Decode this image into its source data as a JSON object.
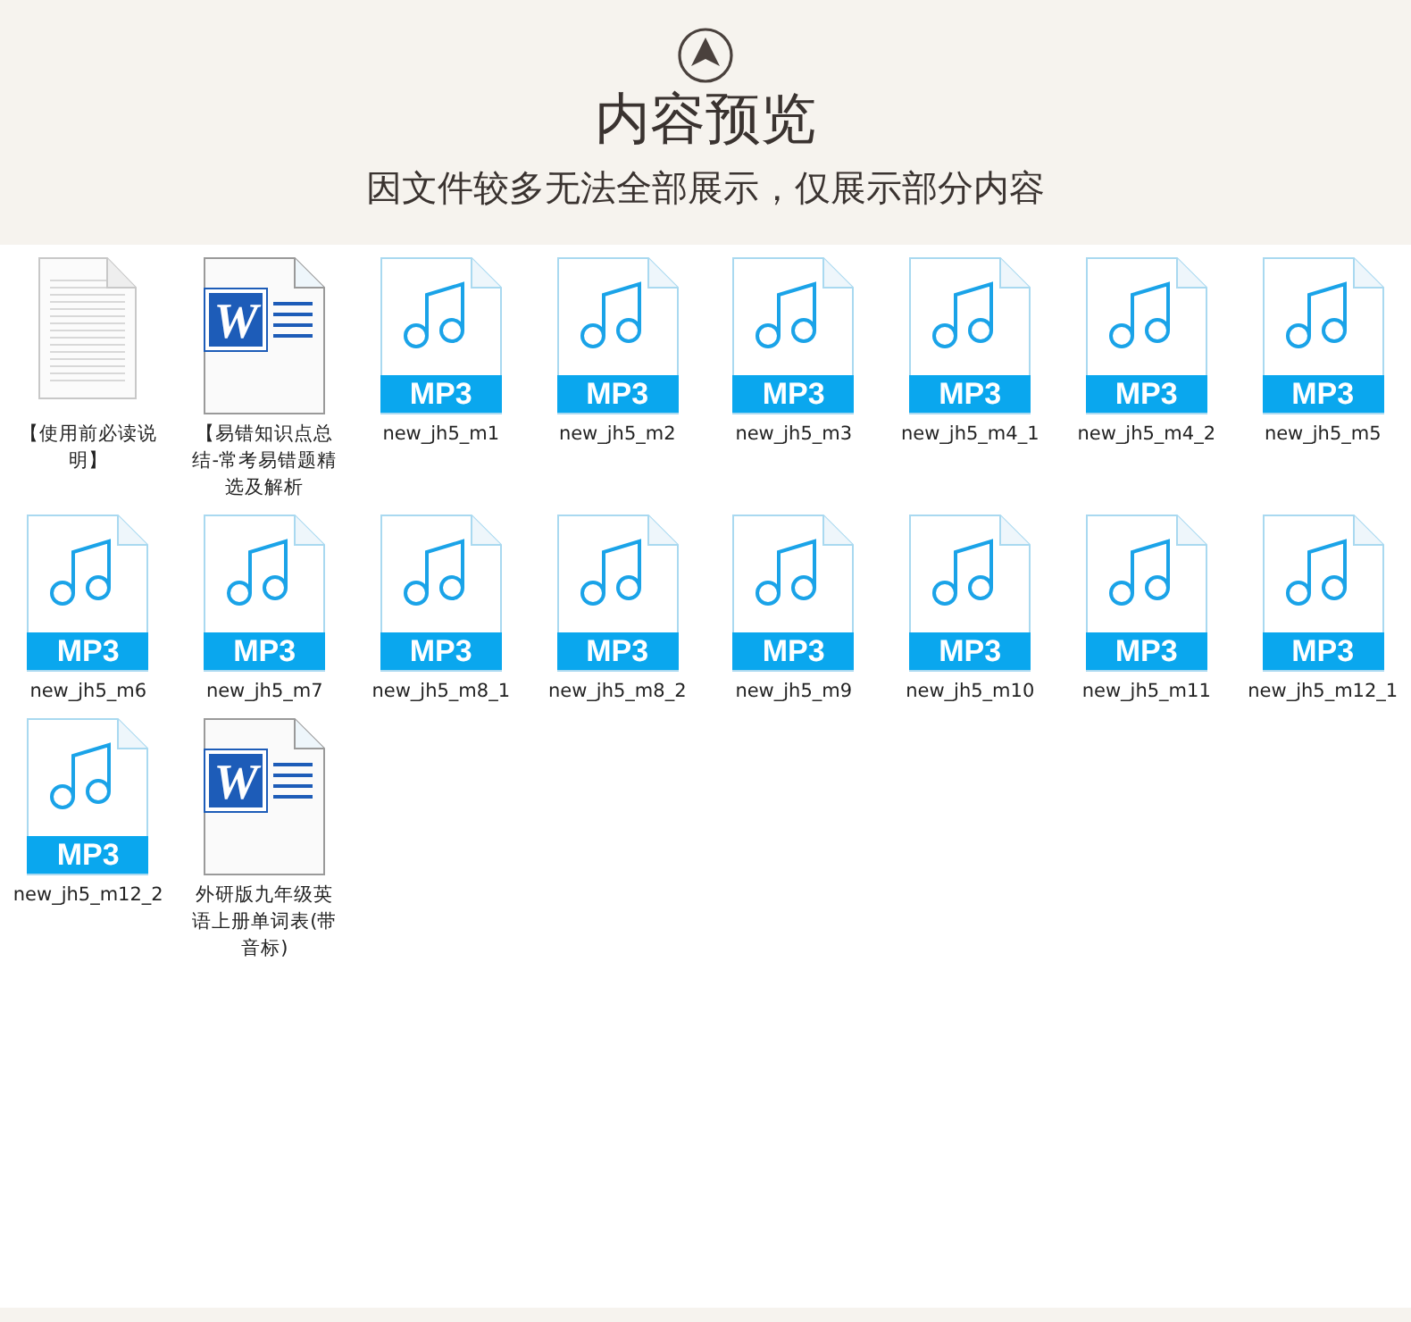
{
  "header": {
    "title": "内容预览",
    "subtitle": "因文件较多无法全部展示，仅展示部分内容"
  },
  "files": [
    {
      "kind": "text",
      "name": "【使用前必读说明】"
    },
    {
      "kind": "word",
      "name": "【易错知识点总结-常考易错题精选及解析",
      "logo_letter": "W"
    },
    {
      "kind": "mp3",
      "name": "new_jh5_m1",
      "badge": "MP3"
    },
    {
      "kind": "mp3",
      "name": "new_jh5_m2",
      "badge": "MP3"
    },
    {
      "kind": "mp3",
      "name": "new_jh5_m3",
      "badge": "MP3"
    },
    {
      "kind": "mp3",
      "name": "new_jh5_m4_1",
      "badge": "MP3"
    },
    {
      "kind": "mp3",
      "name": "new_jh5_m4_2",
      "badge": "MP3"
    },
    {
      "kind": "mp3",
      "name": "new_jh5_m5",
      "badge": "MP3"
    },
    {
      "kind": "mp3",
      "name": "new_jh5_m6",
      "badge": "MP3"
    },
    {
      "kind": "mp3",
      "name": "new_jh5_m7",
      "badge": "MP3"
    },
    {
      "kind": "mp3",
      "name": "new_jh5_m8_1",
      "badge": "MP3"
    },
    {
      "kind": "mp3",
      "name": "new_jh5_m8_2",
      "badge": "MP3"
    },
    {
      "kind": "mp3",
      "name": "new_jh5_m9",
      "badge": "MP3"
    },
    {
      "kind": "mp3",
      "name": "new_jh5_m10",
      "badge": "MP3"
    },
    {
      "kind": "mp3",
      "name": "new_jh5_m11",
      "badge": "MP3"
    },
    {
      "kind": "mp3",
      "name": "new_jh5_m12_1",
      "badge": "MP3"
    },
    {
      "kind": "mp3",
      "name": "new_jh5_m12_2",
      "badge": "MP3"
    },
    {
      "kind": "word",
      "name": "外研版九年级英语上册单词表(带音标)",
      "logo_letter": "W"
    }
  ]
}
